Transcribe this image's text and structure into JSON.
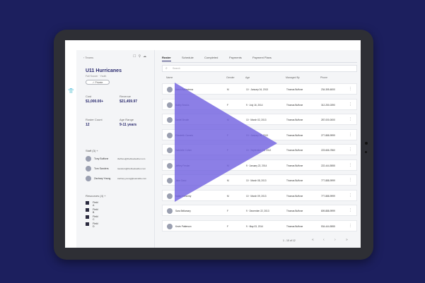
{
  "left_panel": {
    "back_label": "Teams",
    "team_name": "U11 Hurricanes",
    "team_sub": "Fall Soccer · Youth",
    "pill_label": "✓ Private",
    "stats": [
      {
        "label": "Cost",
        "value": "$1,000.00+"
      },
      {
        "label": "Revenue",
        "value": "$21,459.97"
      },
      {
        "label": "Roster Count",
        "value": "12"
      },
      {
        "label": "Age Range",
        "value": "9-11 years"
      }
    ],
    "staff_header": "Staff (3)  +",
    "staff": [
      {
        "name": "Tony Buffone",
        "email": "tbuffone@thebluefeather.com"
      },
      {
        "name": "Tom Sanders",
        "email": "tsanders@thebluefeather.com"
      },
      {
        "name": "Zachary Young",
        "email": "zachary.young@teamable.com"
      }
    ],
    "resources_header": "Resources (4)  +",
    "resources": [
      "Field A",
      "Field B",
      "Field C",
      "Field D"
    ]
  },
  "main": {
    "tabs": [
      "Roster",
      "Schedule",
      "Completed",
      "Payments",
      "Payment Plans"
    ],
    "search_placeholder": "Search",
    "columns": [
      "Name",
      "Gender",
      "Age",
      "Managed By",
      "Phone"
    ],
    "rows": [
      {
        "name": "Aaron Ballesteros",
        "gender": "M",
        "age": "10 · January 04, 2013",
        "managed": "Thomas Buffone",
        "phone": "234-355-6000"
      },
      {
        "name": "Bailey Brooks",
        "gender": "F",
        "age": "9 · July 16, 2014",
        "managed": "Thomas Buffone",
        "phone": "312-250-0390"
      },
      {
        "name": "Daniel Brodie",
        "gender": "M",
        "age": "10 · March 02, 2013",
        "managed": "Thomas Buffone",
        "phone": "287-000-0000"
      },
      {
        "name": "Elizabeth Canario",
        "gender": "F",
        "age": "10 · January 26, 2013",
        "managed": "Thomas Buffone",
        "phone": "277-888-9999"
      },
      {
        "name": "Gabrielle Cohen",
        "gender": "F",
        "age": "10 · September 13, 2012",
        "managed": "Thomas Buffone",
        "phone": "223-666-7860"
      },
      {
        "name": "Jeffrey Fender",
        "gender": "M",
        "age": "9 · January 22, 2014",
        "managed": "Thomas Buffone",
        "phone": "222-444-5555"
      },
      {
        "name": "Jake Gano",
        "gender": "M",
        "age": "10 · March 08, 2013",
        "managed": "Thomas Buffone",
        "phone": "777-888-9999"
      },
      {
        "name": "Kalani Kennedy",
        "gender": "M",
        "age": "10 · March 09, 2013",
        "managed": "Thomas Buffone",
        "phone": "777-888-9999"
      },
      {
        "name": "Sara Bellamary",
        "gender": "F",
        "age": "9 · December 22, 2013",
        "managed": "Thomas Buffone",
        "phone": "809-888-9999"
      },
      {
        "name": "Kevin Patterson",
        "gender": "F",
        "age": "9 · May 03, 2014",
        "managed": "Thomas Buffone",
        "phone": "534-444-5555"
      }
    ],
    "pager_text": "1 - 10 of 12",
    "pager_buttons": [
      "«",
      "‹",
      "›",
      "»"
    ]
  }
}
